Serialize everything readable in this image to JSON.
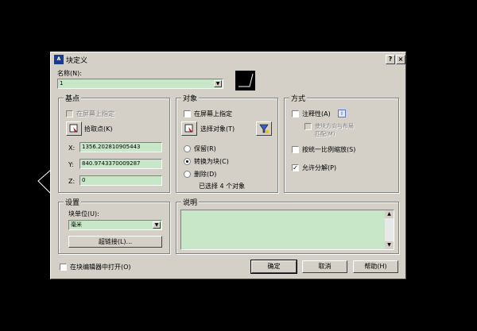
{
  "window": {
    "title": "块定义",
    "help_btn": "?",
    "close_btn": "×"
  },
  "name": {
    "label": "名称(N):",
    "value": "1"
  },
  "basepoint": {
    "title": "基点",
    "specify_on_screen": "在屏幕上指定",
    "pick_point": "拾取点(K)",
    "x_label": "X:",
    "x_value": "1356.202810905443",
    "y_label": "Y:",
    "y_value": "840.9743370009287",
    "z_label": "Z:",
    "z_value": "0"
  },
  "objects": {
    "title": "对象",
    "specify_on_screen": "在屏幕上指定",
    "select_objects": "选择对象(T)",
    "retain": "保留(R)",
    "convert": "转换为块(C)",
    "delete": "删除(D)",
    "selected": "已选择 4 个对象"
  },
  "behavior": {
    "title": "方式",
    "annotative": "注释性(A)",
    "match_orientation": "使块方向与布局",
    "match_orientation_2": "匹配(M)",
    "scale_uniformly": "按统一比例缩放(S)",
    "allow_explode": "允许分解(P)"
  },
  "settings": {
    "title": "设置",
    "unit_label": "块单位(U):",
    "unit_value": "毫米",
    "hyperlink": "超链接(L)..."
  },
  "description": {
    "title": "说明"
  },
  "footer": {
    "open_in_editor": "在块编辑器中打开(O)",
    "ok": "确定",
    "cancel": "取消",
    "help": "帮助(H)"
  }
}
